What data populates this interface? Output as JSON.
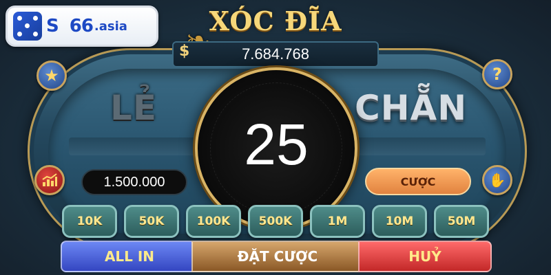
{
  "logo": {
    "brand": "S",
    "number": "66",
    "domain": ".asia"
  },
  "title": "XÓC ĐĨA",
  "balance": {
    "currency_symbol": "$",
    "value": "7.684.768"
  },
  "bet_sides": {
    "odd_label": "LẺ",
    "even_label": "CHẴN"
  },
  "timer": {
    "value": "25"
  },
  "bet": {
    "amount": "1.500.000",
    "button_label": "CƯỢC"
  },
  "chips": [
    "10K",
    "50K",
    "100K",
    "500K",
    "1M",
    "10M",
    "50M"
  ],
  "actions": {
    "all_in": "ALL IN",
    "place_bet": "ĐẶT CƯỢC",
    "cancel": "HUỶ"
  },
  "icons": {
    "star": "star-icon",
    "help": "question-icon",
    "stats": "chart-icon",
    "hand": "hand-icon"
  },
  "colors": {
    "gold": "#f6d77a",
    "bet_button": "#e1823f",
    "all_in": "#3446c1",
    "cancel": "#c32828"
  }
}
